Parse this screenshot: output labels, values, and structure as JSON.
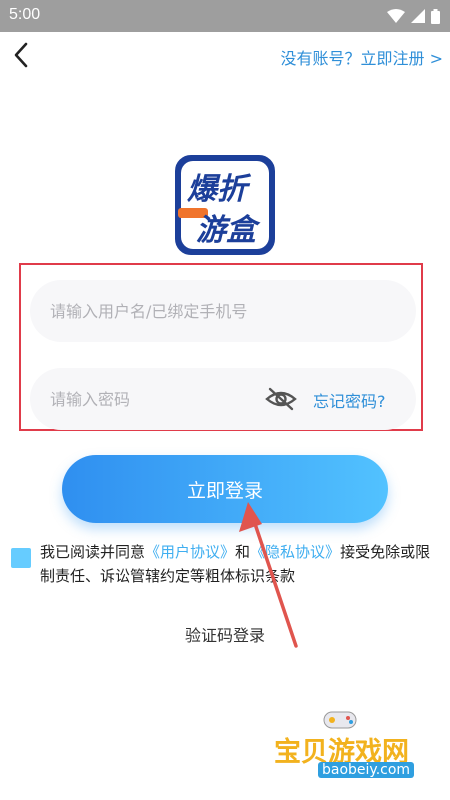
{
  "status": {
    "time": "5:00"
  },
  "header": {
    "register_link": "没有账号？立即注册 >"
  },
  "logo": {
    "line1": "爆折",
    "line2": "游盒"
  },
  "form": {
    "username_placeholder": "请输入用户名/已绑定手机号",
    "password_placeholder": "请输入密码",
    "forgot_password": "忘记密码?"
  },
  "login_button": "立即登录",
  "agreement": {
    "prefix": "我已阅读并同意",
    "user_agreement": "《用户协议》",
    "and": "和",
    "privacy_agreement": "《隐私协议》",
    "suffix": "接受免除或限制责任、诉讼管辖约定等粗体标识条款"
  },
  "sms_login": "验证码登录",
  "watermark": {
    "title": "宝贝游戏网",
    "url": "baobeiy.com"
  },
  "colors": {
    "accent": "#2f8fd8",
    "highlight": "#e03b4a",
    "button_start": "#2f8ff0",
    "button_end": "#52c2ff"
  }
}
